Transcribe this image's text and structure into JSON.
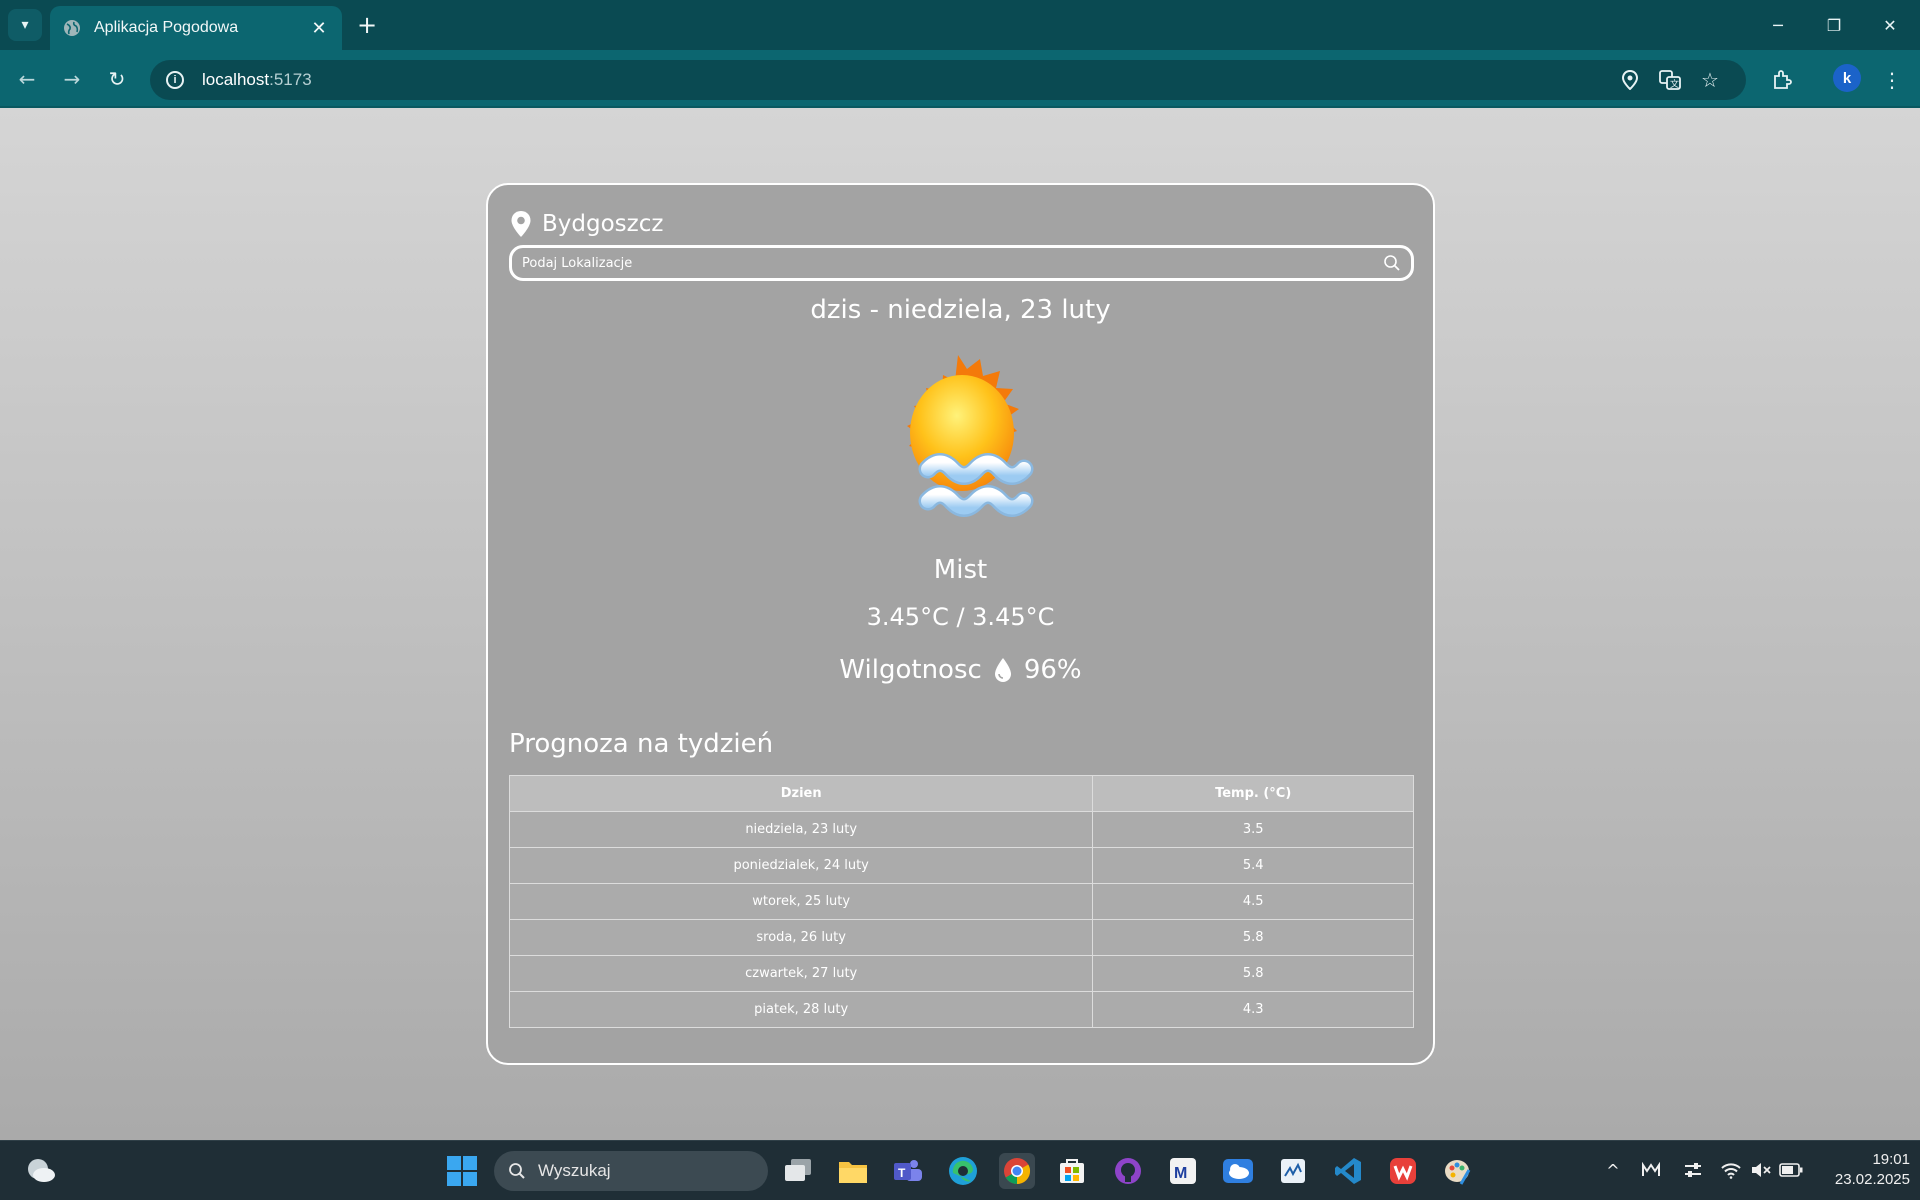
{
  "browser": {
    "tab_title": "Aplikacja Pogodowa",
    "url_host": "localhost",
    "url_port": ":5173",
    "profile_initial": "k"
  },
  "weather": {
    "city": "Bydgoszcz",
    "search_placeholder": "Podaj Lokalizacje",
    "today_label": "dzis - niedziela, 23 luty",
    "description": "Mist",
    "temps": "3.45°C / 3.45°C",
    "humidity_label": "Wilgotnosc",
    "humidity_value": "96%",
    "weather_icon": "sun-with-mist-icon"
  },
  "forecast": {
    "title": "Prognoza na tydzień",
    "headers": [
      "Dzien",
      "Temp. (°C)"
    ],
    "rows": [
      {
        "day": "niedziela, 23 luty",
        "temp": "3.5"
      },
      {
        "day": "poniedzialek, 24 luty",
        "temp": "5.4"
      },
      {
        "day": "wtorek, 25 luty",
        "temp": "4.5"
      },
      {
        "day": "sroda, 26 luty",
        "temp": "5.8"
      },
      {
        "day": "czwartek, 27 luty",
        "temp": "5.8"
      },
      {
        "day": "piatek, 28 luty",
        "temp": "4.3"
      }
    ]
  },
  "taskbar": {
    "search_label": "Wyszukaj",
    "time": "19:01",
    "date": "23.02.2025"
  }
}
